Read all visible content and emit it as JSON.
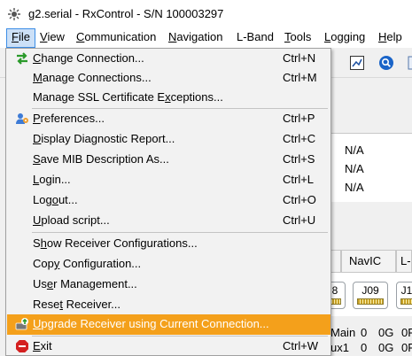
{
  "window": {
    "title": "g2.serial - RxControl - S/N 100003297"
  },
  "menubar": [
    {
      "label": "File",
      "key": "F",
      "rest": "ile"
    },
    {
      "label": "View",
      "key": "V",
      "rest": "iew"
    },
    {
      "label": "Communication",
      "key": "C",
      "rest": "ommunication"
    },
    {
      "label": "Navigation",
      "key": "N",
      "rest": "avigation"
    },
    {
      "label": "L-Band",
      "key": "",
      "rest": "L-Band"
    },
    {
      "label": "Tools",
      "key": "T",
      "rest": "ools"
    },
    {
      "label": "Logging",
      "key": "L",
      "rest": "ogging"
    },
    {
      "label": "Help",
      "key": "H",
      "rest": "elp"
    }
  ],
  "file_menu": {
    "items": [
      {
        "pre": "",
        "key": "C",
        "post": "hange Connection...",
        "label": "Change Connection...",
        "shortcut": "Ctrl+N",
        "icon": "change-connection-icon"
      },
      {
        "pre": "",
        "key": "M",
        "post": "anage Connections...",
        "label": "Manage Connections...",
        "shortcut": "Ctrl+M",
        "icon": ""
      },
      {
        "pre": "Manage SSL Certificate E",
        "key": "x",
        "post": "ceptions...",
        "label": "Manage SSL Certificate Exceptions...",
        "shortcut": "",
        "icon": ""
      },
      {
        "pre": "",
        "key": "P",
        "post": "references...",
        "label": "Preferences...",
        "shortcut": "Ctrl+P",
        "icon": "preferences-icon"
      },
      {
        "pre": "",
        "key": "D",
        "post": "isplay Diagnostic Report...",
        "label": "Display Diagnostic Report...",
        "shortcut": "Ctrl+C",
        "icon": ""
      },
      {
        "pre": "",
        "key": "S",
        "post": "ave MIB Description As...",
        "label": "Save MIB Description As...",
        "shortcut": "Ctrl+S",
        "icon": ""
      },
      {
        "pre": "",
        "key": "L",
        "post": "ogin...",
        "label": "Login...",
        "shortcut": "Ctrl+L",
        "icon": ""
      },
      {
        "pre": "Log",
        "key": "o",
        "post": "ut...",
        "label": "Logout...",
        "shortcut": "Ctrl+O",
        "icon": ""
      },
      {
        "pre": "",
        "key": "U",
        "post": "pload script...",
        "label": "Upload script...",
        "shortcut": "Ctrl+U",
        "icon": ""
      },
      {
        "pre": "S",
        "key": "h",
        "post": "ow Receiver Configurations...",
        "label": "Show Receiver Configurations...",
        "shortcut": "",
        "icon": ""
      },
      {
        "pre": "Cop",
        "key": "y",
        "post": " Configuration...",
        "label": "Copy Configuration...",
        "shortcut": "",
        "icon": ""
      },
      {
        "pre": "Us",
        "key": "e",
        "post": "r Management...",
        "label": "User Management...",
        "shortcut": "",
        "icon": ""
      },
      {
        "pre": "Rese",
        "key": "t",
        "post": " Receiver...",
        "label": "Reset Receiver...",
        "shortcut": "",
        "icon": ""
      },
      {
        "pre": "",
        "key": "U",
        "post": "pgrade Receiver using Current Connection...",
        "label": "Upgrade Receiver using Current Connection...",
        "shortcut": "",
        "icon": "upgrade-icon"
      },
      {
        "pre": "",
        "key": "E",
        "post": "xit",
        "label": "Exit",
        "shortcut": "Ctrl+W",
        "icon": "exit-icon"
      }
    ]
  },
  "background": {
    "na_values": [
      "N/A",
      "N/A",
      "N/A"
    ],
    "tabs": [
      "NavIC",
      "L-"
    ],
    "satellites": [
      "8",
      "J09",
      "J1"
    ],
    "status_rows": [
      {
        "name": "Main",
        "a": "0",
        "b": "0G",
        "c": "0F"
      },
      {
        "name": "ux1",
        "a": "0",
        "b": "0G",
        "c": "0F"
      }
    ]
  },
  "colors": {
    "highlight": "#f4a01b",
    "menu_active_bg": "#cce0f7",
    "menu_active_border": "#3d8ee6"
  }
}
